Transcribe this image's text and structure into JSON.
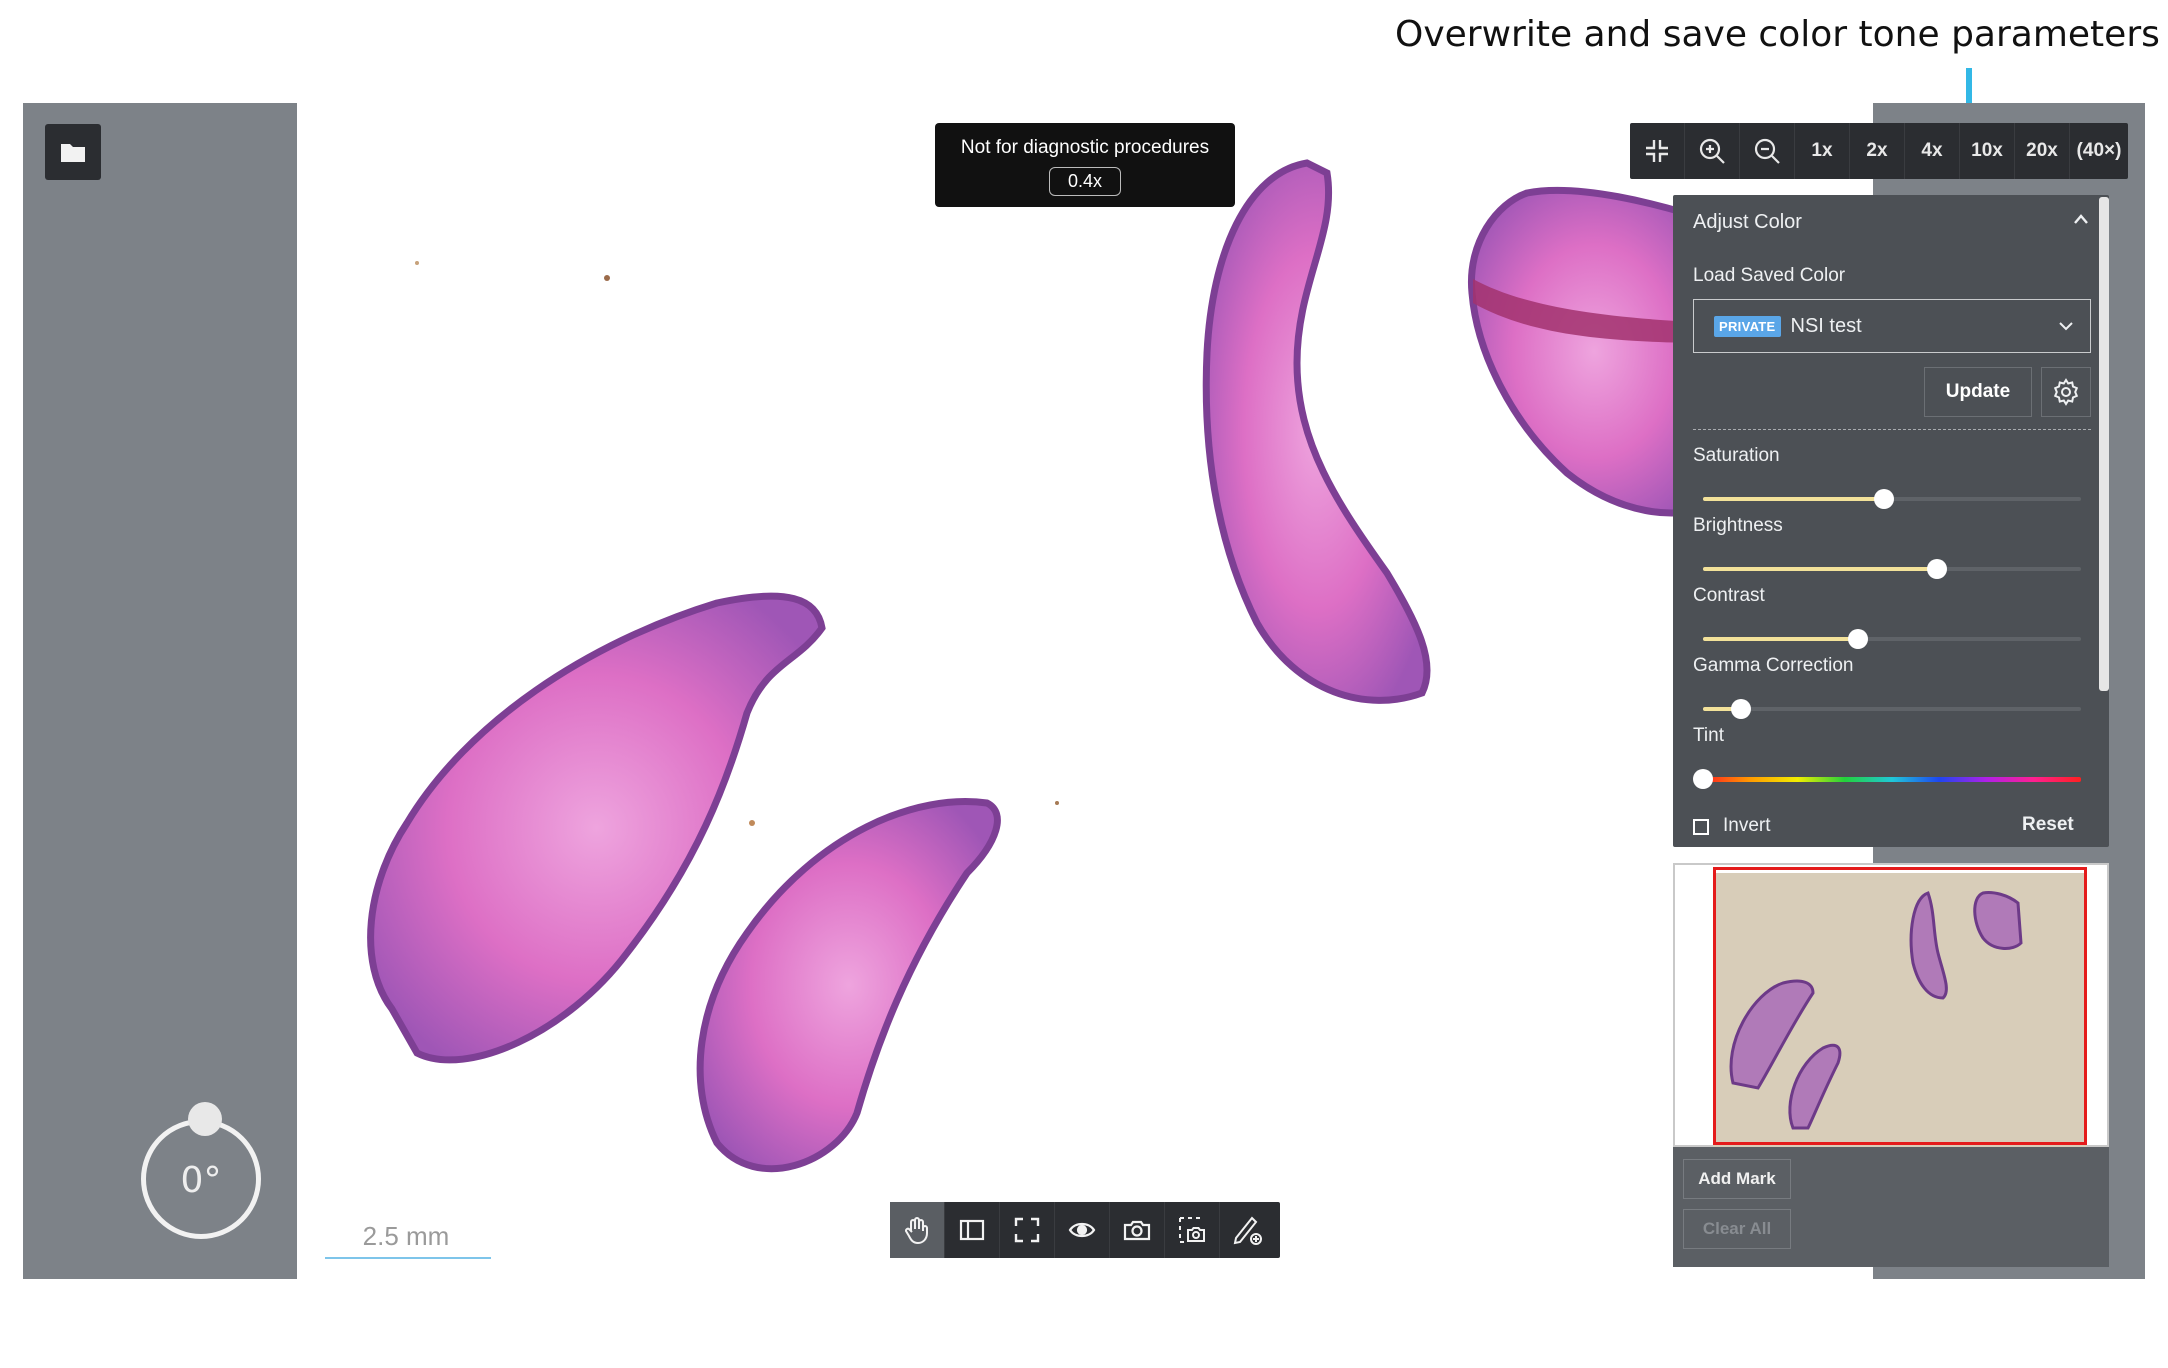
{
  "annotation": {
    "text": "Overwrite and save color tone parameters"
  },
  "toolbar_top": {
    "icons": [
      "fit-screen-icon",
      "zoom-in-icon",
      "zoom-out-icon"
    ],
    "zoom_levels": [
      "1x",
      "2x",
      "4x",
      "10x",
      "20x",
      "(40×)"
    ]
  },
  "notice": {
    "text": "Not for diagnostic procedures",
    "zoom": "0.4x"
  },
  "adjust_color": {
    "title": "Adjust Color",
    "load_saved_label": "Load Saved Color",
    "badge": "PRIVATE",
    "selected_color": "NSI test",
    "update_label": "Update",
    "sliders": {
      "saturation": {
        "label": "Saturation",
        "value": 0.48
      },
      "brightness": {
        "label": "Brightness",
        "value": 0.62
      },
      "contrast": {
        "label": "Contrast",
        "value": 0.41
      },
      "gamma": {
        "label": "Gamma Correction",
        "value": 0.1
      },
      "tint": {
        "label": "Tint",
        "value": 0.0
      }
    },
    "invert_label": "Invert",
    "reset_label": "Reset"
  },
  "marks": {
    "add_label": "Add Mark",
    "clear_label": "Clear All"
  },
  "rotation": {
    "value": "0°"
  },
  "scale": {
    "label": "2.5 mm"
  },
  "colors": {
    "accent": "#32b8e6",
    "tissue_pink": "#e070c8",
    "tissue_purple": "#7d3f94",
    "navigator_frame": "#e41b1b"
  }
}
